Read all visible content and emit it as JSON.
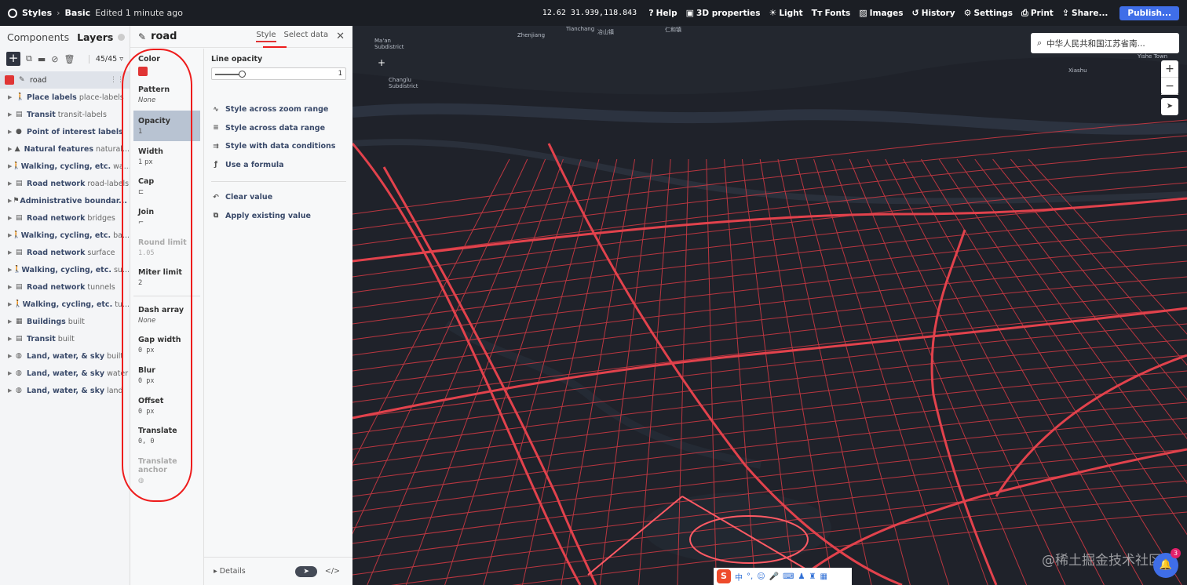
{
  "topbar": {
    "app_label": "Styles",
    "style_name": "Basic",
    "edited": "Edited 1 minute ago",
    "coords": "12.62 31.939,118.843",
    "items": [
      {
        "icon": "help-icon",
        "glyph": "?",
        "label": "Help"
      },
      {
        "icon": "cube-icon",
        "glyph": "▣",
        "label": "3D properties"
      },
      {
        "icon": "sun-icon",
        "glyph": "☀",
        "label": "Light"
      },
      {
        "icon": "fonts-icon",
        "glyph": "Tт",
        "label": "Fonts"
      },
      {
        "icon": "image-icon",
        "glyph": "▨",
        "label": "Images"
      },
      {
        "icon": "history-icon",
        "glyph": "↺",
        "label": "History"
      },
      {
        "icon": "gear-icon",
        "glyph": "⚙",
        "label": "Settings"
      },
      {
        "icon": "print-icon",
        "glyph": "⎙",
        "label": "Print"
      },
      {
        "icon": "share-icon",
        "glyph": "⇪",
        "label": "Share..."
      }
    ],
    "publish": "Publish..."
  },
  "left_panel": {
    "tabs": {
      "components": "Components",
      "layers": "Layers"
    },
    "count": "45/45",
    "selected_layer": "road",
    "layers": [
      {
        "icon": "walk-icon",
        "glyph": "🚶",
        "name": "Place labels",
        "sub": "place-labels"
      },
      {
        "icon": "bus-icon",
        "glyph": "▤",
        "name": "Transit",
        "sub": "transit-labels"
      },
      {
        "icon": "pin-icon",
        "glyph": "●",
        "name": "Point of interest labels",
        "sub": ""
      },
      {
        "icon": "mountain-icon",
        "glyph": "▲",
        "name": "Natural features",
        "sub": "natural..."
      },
      {
        "icon": "walk-icon",
        "glyph": "🚶",
        "name": "Walking, cycling, etc.",
        "sub": "wa..."
      },
      {
        "icon": "car-icon",
        "glyph": "▤",
        "name": "Road network",
        "sub": "road-labels"
      },
      {
        "icon": "flag-icon",
        "glyph": "⚑",
        "name": "Administrative boundar...",
        "sub": ""
      },
      {
        "icon": "car-icon",
        "glyph": "▤",
        "name": "Road network",
        "sub": "bridges"
      },
      {
        "icon": "walk-icon",
        "glyph": "🚶",
        "name": "Walking, cycling, etc.",
        "sub": "ba..."
      },
      {
        "icon": "car-icon",
        "glyph": "▤",
        "name": "Road network",
        "sub": "surface"
      },
      {
        "icon": "walk-icon",
        "glyph": "🚶",
        "name": "Walking, cycling, etc.",
        "sub": "su..."
      },
      {
        "icon": "car-icon",
        "glyph": "▤",
        "name": "Road network",
        "sub": "tunnels"
      },
      {
        "icon": "walk-icon",
        "glyph": "🚶",
        "name": "Walking, cycling, etc.",
        "sub": "tu..."
      },
      {
        "icon": "building-icon",
        "glyph": "▦",
        "name": "Buildings",
        "sub": "built"
      },
      {
        "icon": "bus-icon",
        "glyph": "▤",
        "name": "Transit",
        "sub": "built"
      },
      {
        "icon": "globe-icon",
        "glyph": "◍",
        "name": "Land, water, & sky",
        "sub": "built"
      },
      {
        "icon": "globe-icon",
        "glyph": "◍",
        "name": "Land, water, & sky",
        "sub": "water"
      },
      {
        "icon": "globe-icon",
        "glyph": "◍",
        "name": "Land, water, & sky",
        "sub": "land"
      }
    ]
  },
  "editor": {
    "layer_name": "road",
    "tab_style": "Style",
    "tab_select_data": "Select data",
    "properties": [
      {
        "label": "Color",
        "value": "",
        "kind": "color",
        "color": "#e03535"
      },
      {
        "label": "Pattern",
        "value": "None",
        "kind": "italic"
      },
      {
        "label": "Opacity",
        "value": "1",
        "kind": "normal",
        "active": true
      },
      {
        "label": "Width",
        "value": "1 px",
        "kind": "normal"
      },
      {
        "label": "Cap",
        "value": "⊏",
        "kind": "icon"
      },
      {
        "label": "Join",
        "value": "⌐",
        "kind": "icon"
      },
      {
        "label": "Round limit",
        "value": "1.05",
        "kind": "mono",
        "disabled": true
      },
      {
        "label": "Miter limit",
        "value": "2",
        "kind": "normal"
      }
    ],
    "properties2": [
      {
        "label": "Dash array",
        "value": "None",
        "kind": "italic"
      },
      {
        "label": "Gap width",
        "value": "0 px",
        "kind": "mono"
      },
      {
        "label": "Blur",
        "value": "0 px",
        "kind": "mono"
      },
      {
        "label": "Offset",
        "value": "0 px",
        "kind": "mono"
      },
      {
        "label": "Translate",
        "value": "0, 0",
        "kind": "mono"
      },
      {
        "label": "Translate anchor",
        "value": "◍",
        "kind": "icon",
        "disabled": true
      }
    ],
    "detail": {
      "label": "Line opacity",
      "value": "1",
      "options": [
        {
          "icon": "zoom-range-icon",
          "glyph": "∿",
          "label": "Style across zoom range"
        },
        {
          "icon": "data-range-icon",
          "glyph": "≡",
          "label": "Style across data range"
        },
        {
          "icon": "conditions-icon",
          "glyph": "⇉",
          "label": "Style with data conditions"
        },
        {
          "icon": "formula-icon",
          "glyph": "ƒ",
          "label": "Use a formula"
        }
      ],
      "options2": [
        {
          "icon": "undo-icon",
          "glyph": "↶",
          "label": "Clear value"
        },
        {
          "icon": "apply-icon",
          "glyph": "⧉",
          "label": "Apply existing value"
        }
      ]
    },
    "footer": {
      "details": "▸ Details",
      "code": "</>"
    }
  },
  "map": {
    "search_value": "中华人民共和国江苏省南...",
    "labels": [
      {
        "text": "Zhenjiang",
        "cls": "l1"
      },
      {
        "text": "Tianchang",
        "cls": "l2"
      },
      {
        "text": "冶山镇",
        "cls": "l3"
      },
      {
        "text": "仁和镇",
        "cls": "l4"
      },
      {
        "text": "Ma'an Subdistrict",
        "cls": "l5"
      },
      {
        "text": "Changlu Subdistrict",
        "cls": "l6"
      },
      {
        "text": "Xiashu",
        "cls": "l7"
      },
      {
        "text": "Yishe Town",
        "cls": "l8"
      }
    ],
    "watermark": "@稀土掘金技术社区",
    "notif_count": "3",
    "ime_label": "中"
  },
  "colors": {
    "accent": "#3f6ee8",
    "road": "#e03535",
    "annotation": "#ee1c1c"
  }
}
